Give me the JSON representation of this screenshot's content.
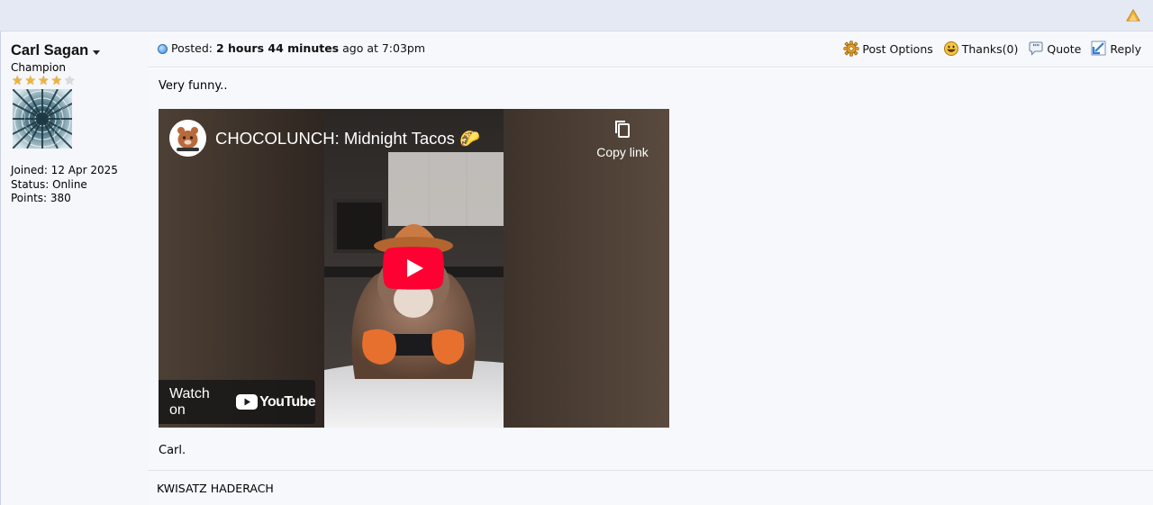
{
  "post": {
    "posted_label": "Posted:",
    "posted_time": "2 hours 44 minutes",
    "posted_suffix": "ago at 7:03pm",
    "message": "Very funny..",
    "signoff": "Carl.",
    "signature": "KWISATZ HADERACH"
  },
  "user": {
    "name": "Carl Sagan",
    "rank": "Champion",
    "stars_filled": 4,
    "stars_total": 5,
    "joined": "Joined: 12 Apr 2025",
    "status": "Status: Online",
    "points": "Points: 380"
  },
  "actions": {
    "post_options": "Post Options",
    "thanks": "Thanks(0)",
    "quote": "Quote",
    "reply": "Reply"
  },
  "video": {
    "title": "CHOCOLUNCH: Midnight Tacos 🌮",
    "copy_link": "Copy link",
    "watch_on": "Watch on",
    "platform": "YouTube",
    "play_color": "#ff0033"
  },
  "icons": {
    "scroll_top": "up-arrow-icon",
    "post_options": "gear-icon",
    "thanks": "smiley-icon",
    "quote": "quote-bubble-icon",
    "reply": "reply-arrow-icon"
  }
}
